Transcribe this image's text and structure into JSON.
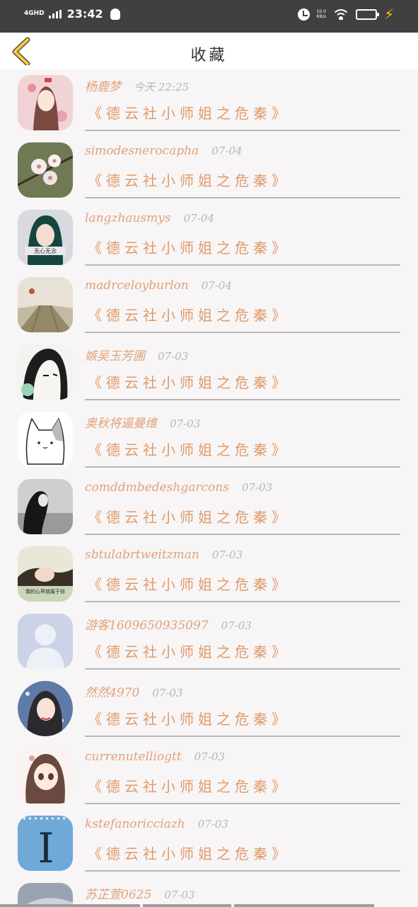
{
  "status_bar": {
    "network": "4GHD",
    "time": "23:42",
    "speed_value": "10.0",
    "speed_unit": "KB/s",
    "battery": "64"
  },
  "header": {
    "title": "收藏"
  },
  "items": [
    {
      "name": "杨鹿梦",
      "time": "今天 22:25",
      "work": "《德云社小师姐之危秦》"
    },
    {
      "name": "simodesnerocapha",
      "time": "07-04",
      "work": "《德云社小师姐之危秦》"
    },
    {
      "name": "langzhausmys",
      "time": "07-04",
      "work": "《德云社小师姐之危秦》"
    },
    {
      "name": "madrceloyburlon",
      "time": "07-04",
      "work": "《德云社小师姐之危秦》"
    },
    {
      "name": "嫉吴玉芳圃",
      "time": "07-03",
      "work": "《德云社小师姐之危秦》"
    },
    {
      "name": "奥秋将逼曼维",
      "time": "07-03",
      "work": "《德云社小师姐之危秦》"
    },
    {
      "name": "comddmbedeshgarcons",
      "time": "07-03",
      "work": "《德云社小师姐之危秦》"
    },
    {
      "name": "sbtulabrtweitzman",
      "time": "07-03",
      "work": "《德云社小师姐之危秦》"
    },
    {
      "name": "游客1609650935097",
      "time": "07-03",
      "work": "《德云社小师姐之危秦》"
    },
    {
      "name": "然然4970",
      "time": "07-03",
      "work": "《德云社小师姐之危秦》"
    },
    {
      "name": "currenutelliogtt",
      "time": "07-03",
      "work": "《德云社小师姐之危秦》"
    },
    {
      "name": "kstefanoricciazh",
      "time": "07-03",
      "work": "《德云社小师姐之危秦》"
    },
    {
      "name": "苏芷萱0625",
      "time": "07-03",
      "work": "《德云社小师姐之危秦》"
    }
  ],
  "avatar_texts": {
    "item_3": "无心无念",
    "item_8": "我的心早就属于你",
    "item_12": "I"
  },
  "colors": {
    "name": "#e0a27a",
    "work": "#e09a6a",
    "time": "#b9b5b5",
    "back": "#f2c94c",
    "divider": "#b9b6b6"
  }
}
